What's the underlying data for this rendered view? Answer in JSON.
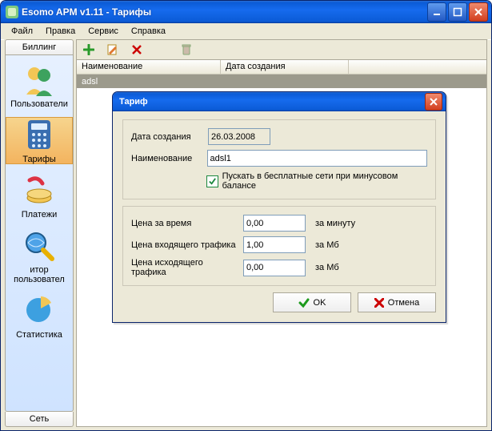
{
  "window": {
    "title": "Esomo APM v1.11 - Тарифы"
  },
  "menu": {
    "file": "Файл",
    "edit": "Правка",
    "service": "Сервис",
    "help": "Справка"
  },
  "sidebar": {
    "top_tab": "Биллинг",
    "bottom_tab": "Сеть",
    "items": [
      {
        "label": "Пользователи"
      },
      {
        "label": "Тарифы"
      },
      {
        "label": "Платежи"
      },
      {
        "label": "итор пользовател"
      },
      {
        "label": "Статистика"
      }
    ]
  },
  "table": {
    "col_name": "Наименование",
    "col_date": "Дата создания",
    "rows": [
      {
        "name": "adsl"
      }
    ]
  },
  "modal": {
    "title": "Тариф",
    "date_label": "Дата создания",
    "date_value": "26.03.2008",
    "name_label": "Наименование",
    "name_value": "adsl1",
    "check_label": "Пускать в бесплатные сети при минусовом балансе",
    "check_value": true,
    "price_time_label": "Цена за время",
    "price_time_value": "0,00",
    "price_time_unit": "за минуту",
    "price_in_label": "Цена входящего трафика",
    "price_in_value": "1,00",
    "price_in_unit": "за Мб",
    "price_out_label": "Цена исходящего трафика",
    "price_out_value": "0,00",
    "price_out_unit": "за Мб",
    "ok": "OK",
    "cancel": "Отмена"
  }
}
